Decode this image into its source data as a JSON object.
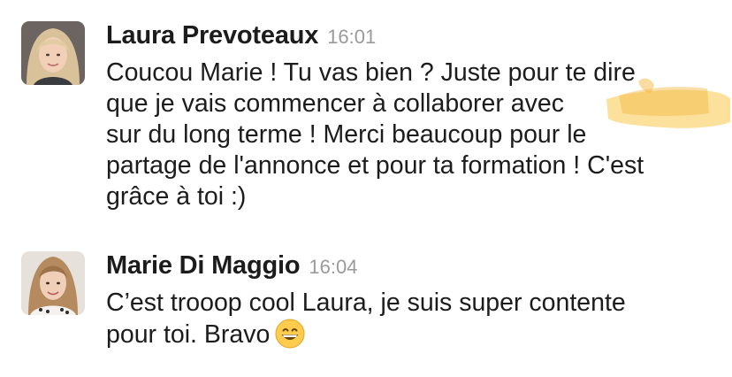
{
  "messages": [
    {
      "author": "Laura Prevoteaux",
      "time": "16:01",
      "lines": [
        "Coucou Marie ! Tu vas bien ? Juste pour te dire",
        "que je vais commencer à collaborer avec",
        "sur du long terme ! Merci beaucoup pour le",
        "partage de l'annonce et pour ta formation ! C'est",
        "grâce à toi :)"
      ],
      "avatar_icon": "user-avatar-icon"
    },
    {
      "author": "Marie Di Maggio",
      "time": "16:04",
      "lines": [
        "C’est trooop cool Laura, je suis super contente",
        "pour toi. Bravo"
      ],
      "emoji": "grinning-face-emoji",
      "avatar_icon": "user-avatar-icon"
    }
  ],
  "colors": {
    "text": "#1d1c1d",
    "timestamp": "#9a9a9a",
    "highlighter": "#f7c948"
  }
}
